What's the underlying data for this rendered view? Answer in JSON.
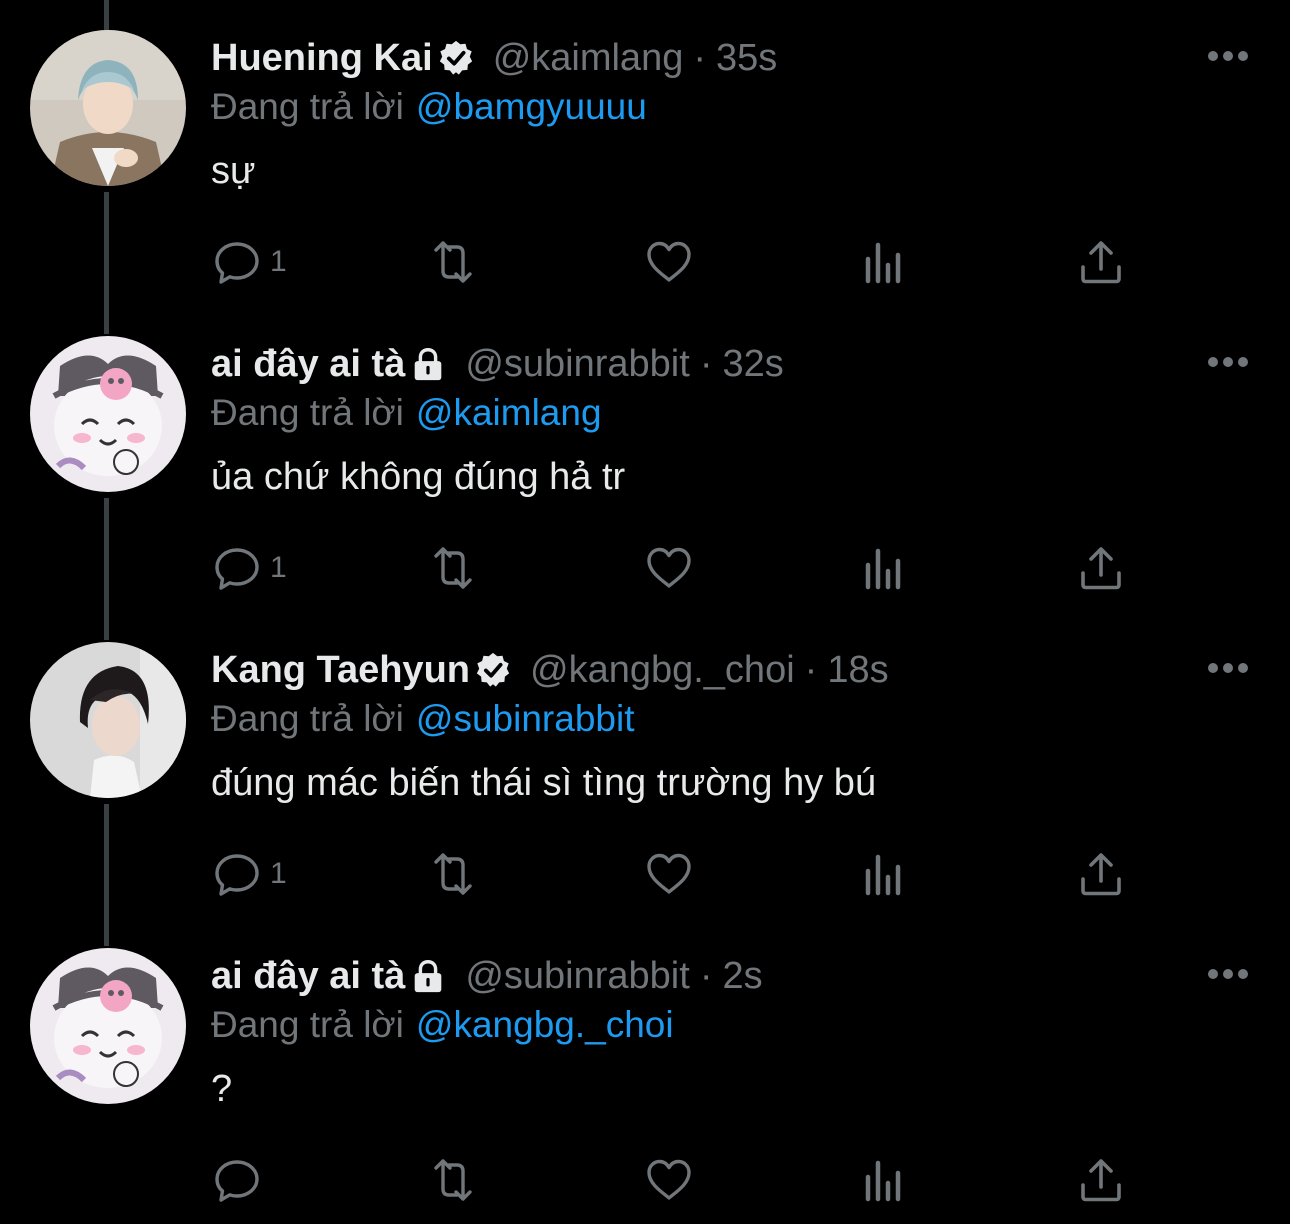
{
  "reply_prefix": "Đang trả lời",
  "colors": {
    "background": "#000000",
    "text_primary": "#e7e9ea",
    "text_secondary": "#71767b",
    "link": "#1d9bf0",
    "thread_line": "#3a3f44"
  },
  "tweets": [
    {
      "display_name": "Huening Kai",
      "badge": "verified-icon",
      "handle": "@kaimlang",
      "separator": "·",
      "time": "35s",
      "reply_to": "@bamgyuuuu",
      "content": "sự",
      "reply_count": "1",
      "avatar": "avatar-photo-blue-hair"
    },
    {
      "display_name": "ai đây ai tà",
      "badge": "lock-icon",
      "handle": "@subinrabbit",
      "separator": "·",
      "time": "32s",
      "reply_to": "@kaimlang",
      "content": "ủa chứ không đúng hả tr",
      "reply_count": "1",
      "avatar": "avatar-kuromi-cartoon"
    },
    {
      "display_name": "Kang Taehyun",
      "badge": "verified-icon",
      "handle": "@kangbg._choi",
      "separator": "·",
      "time": "18s",
      "reply_to": "@subinrabbit",
      "content": "đúng mác biến thái sì tìng trường hy bú",
      "reply_count": "1",
      "avatar": "avatar-photo-dark-hair"
    },
    {
      "display_name": "ai đây ai tà",
      "badge": "lock-icon",
      "handle": "@subinrabbit",
      "separator": "·",
      "time": "2s",
      "reply_to": "@kangbg._choi",
      "content": "?",
      "reply_count": "",
      "avatar": "avatar-kuromi-cartoon"
    }
  ],
  "action_icons": [
    "reply-icon",
    "retweet-icon",
    "like-icon",
    "views-icon",
    "share-icon"
  ],
  "more_icon": "more-icon"
}
